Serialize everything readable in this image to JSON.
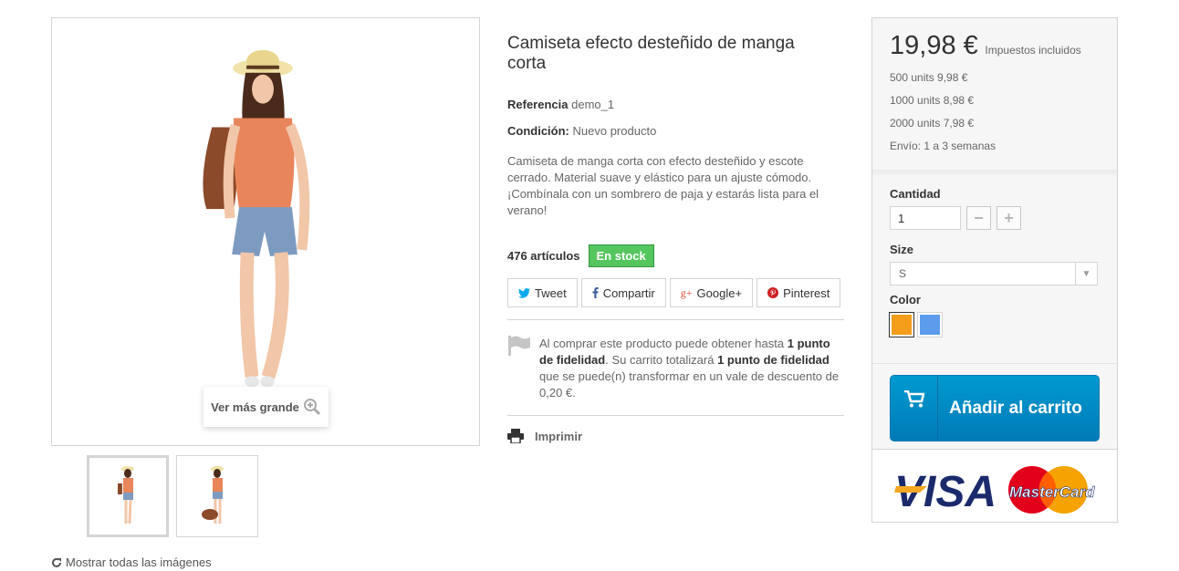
{
  "gallery": {
    "zoom_label": "Ver más grande",
    "show_all_label": "Mostrar todas las imágenes"
  },
  "product": {
    "title": "Camiseta efecto desteñido de manga corta",
    "reference_label": "Referencia",
    "reference_value": "demo_1",
    "condition_label": "Condición:",
    "condition_value": "Nuevo producto",
    "description": "Camiseta de manga corta con efecto desteñido y escote cerrado. Material suave y elástico para un ajuste cómodo. ¡Combínala con un sombrero de paja y estarás lista para el verano!",
    "stock_count": "476 artículos",
    "stock_status": "En stock"
  },
  "share": {
    "tweet": "Tweet",
    "facebook": "Compartir",
    "google": "Google+",
    "pinterest": "Pinterest"
  },
  "loyalty": {
    "text_1": "Al comprar este producto puede obtener hasta ",
    "points_1": "1 punto de fidelidad",
    "text_2": ". Su carrito totalizará ",
    "points_2": "1 punto de fidelidad",
    "text_3": " que se puede(n) transformar en un vale de descuento de 0,20 €."
  },
  "print_label": "Imprimir",
  "buybox": {
    "price": "19,98 €",
    "tax_label": "Impuestos incluidos",
    "quantity_discounts": [
      "500 units 9,98 €",
      "1000 units 8,98 €",
      "2000 units 7,98 €"
    ],
    "shipping": "Envío: 1 a 3 semanas",
    "quantity_label": "Cantidad",
    "quantity_value": "1",
    "minus": "−",
    "plus": "+",
    "size_label": "Size",
    "size_value": "S",
    "color_label": "Color",
    "colors": [
      "#f39d1b",
      "#5d9cec"
    ],
    "cart_label": "Añadir al carrito",
    "payment_logos": [
      "VISA",
      "MasterCard"
    ]
  }
}
